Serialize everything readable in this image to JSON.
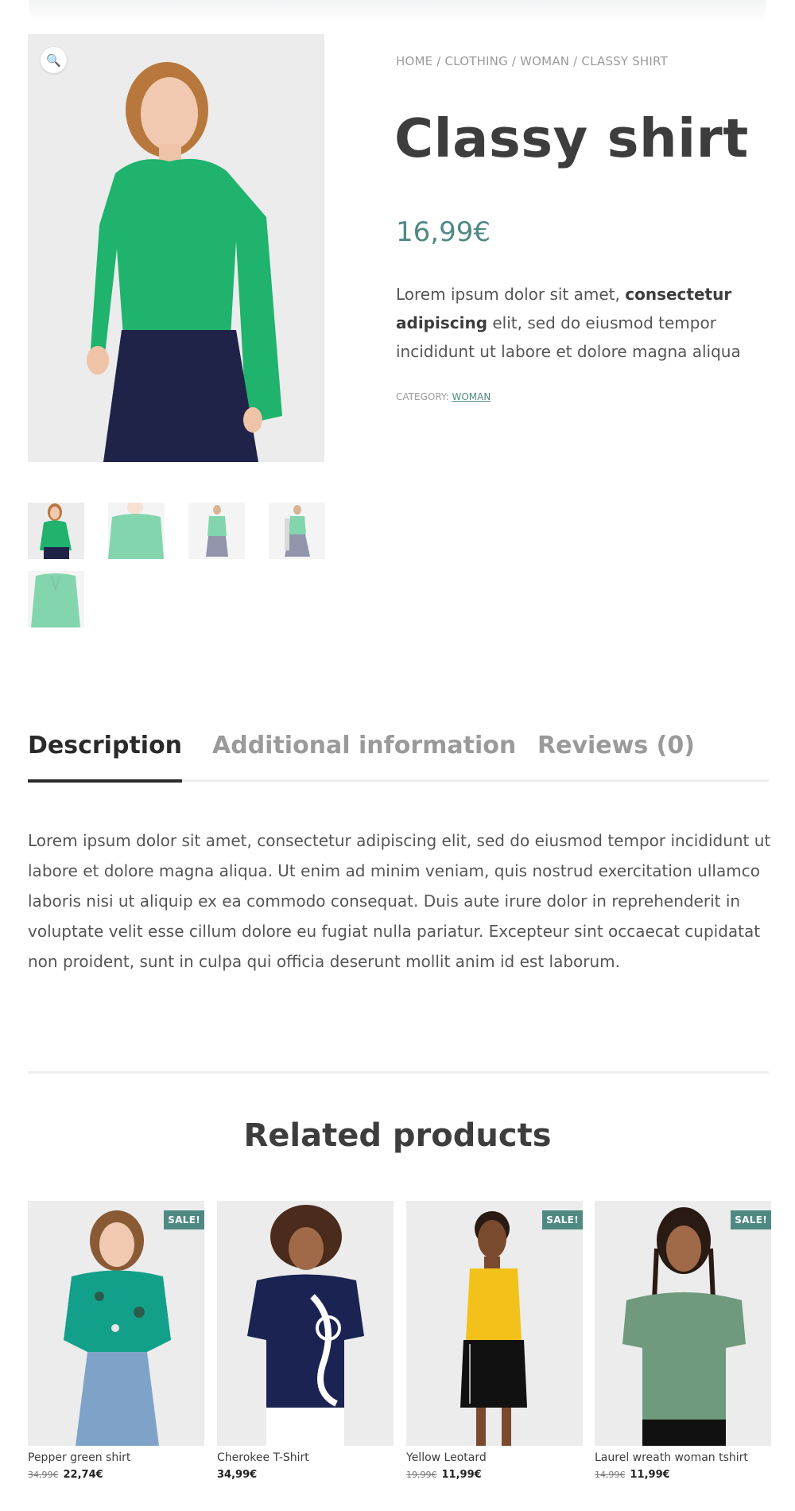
{
  "breadcrumb": {
    "home": "HOME",
    "sep": " / ",
    "clothing": "CLOTHING",
    "woman": "WOMAN",
    "current": "CLASSY SHIRT"
  },
  "product": {
    "title": "Classy shirt",
    "price": "16,99€",
    "short_description": {
      "part1": "Lorem ipsum dolor sit amet, ",
      "bold": "consectetur adipiscing",
      "part2": " elit, sed do eiusmod tempor incididunt ut labore et dolore magna aliqua"
    },
    "category_label": "CATEGORY: ",
    "category_link": "WOMAN"
  },
  "gallery": {
    "zoom_icon": "magnifier-icon",
    "thumbnails": 5
  },
  "tabs": [
    {
      "label": "Description"
    },
    {
      "label": "Additional information"
    },
    {
      "label": "Reviews (0)"
    }
  ],
  "description": "Lorem ipsum dolor sit amet, consectetur adipiscing elit, sed do eiusmod tempor incididunt ut labore et dolore magna aliqua. Ut enim ad minim veniam, quis nostrud exercitation ullamco laboris nisi ut aliquip ex ea commodo consequat. Duis aute irure dolor in reprehenderit in voluptate velit esse cillum dolore eu fugiat nulla pariatur. Excepteur sint occaecat cupidatat non proident, sunt in culpa qui officia deserunt mollit anim id est laborum.",
  "related": {
    "title": "Related products",
    "items": [
      {
        "name": "Pepper green shirt",
        "sale_badge": "SALE!",
        "old_price": "34,99€",
        "price": "22,74€"
      },
      {
        "name": "Cherokee T-Shirt",
        "sale_badge": "",
        "old_price": "",
        "price": "34,99€"
      },
      {
        "name": "Yellow Leotard",
        "sale_badge": "SALE!",
        "old_price": "19,99€",
        "price": "11,99€"
      },
      {
        "name": "Laurel wreath woman tshirt",
        "sale_badge": "SALE!",
        "old_price": "14,99€",
        "price": "11,99€"
      }
    ]
  },
  "colors": {
    "accent": "#4f8a82",
    "text": "#3d3d3d",
    "muted": "#9a9a9a"
  }
}
